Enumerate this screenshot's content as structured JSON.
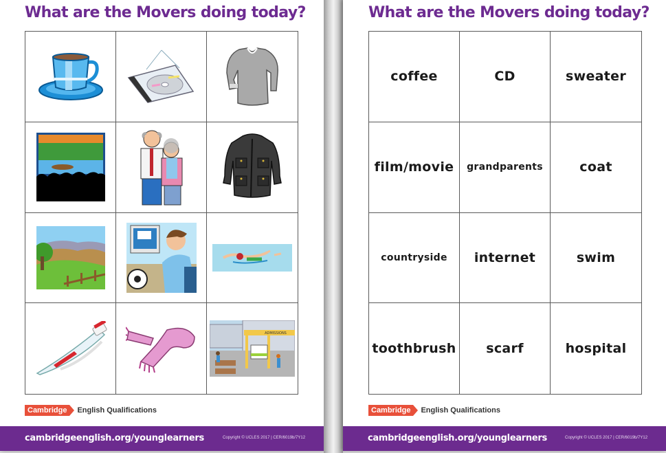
{
  "left_page": {
    "title": "What are the Movers doing today?",
    "picture_cards": [
      {
        "icon": "coffee-cup-icon",
        "label": "coffee"
      },
      {
        "icon": "cd-icon",
        "label": "CD"
      },
      {
        "icon": "sweater-icon",
        "label": "sweater"
      },
      {
        "icon": "film-icon",
        "label": "film/movie"
      },
      {
        "icon": "grandparents-icon",
        "label": "grandparents"
      },
      {
        "icon": "coat-icon",
        "label": "coat"
      },
      {
        "icon": "countryside-icon",
        "label": "countryside"
      },
      {
        "icon": "internet-icon",
        "label": "internet"
      },
      {
        "icon": "swim-icon",
        "label": "swim"
      },
      {
        "icon": "toothbrush-icon",
        "label": "toothbrush"
      },
      {
        "icon": "scarf-icon",
        "label": "scarf"
      },
      {
        "icon": "hospital-icon",
        "label": "hospital"
      }
    ],
    "hospital_sign": "ADMISSIONS",
    "logo": {
      "brand": "Cambridge",
      "tagline": "English Qualifications"
    },
    "footer": {
      "url": "cambridgeenglish.org/younglearners",
      "copyright": "Copyright © UCLES 2017 | CER/6019b/7Y12"
    }
  },
  "right_page": {
    "title": "What are the Movers doing today?",
    "word_cards": [
      "coffee",
      "CD",
      "sweater",
      "film/movie",
      "grandparents",
      "coat",
      "countryside",
      "internet",
      "swim",
      "toothbrush",
      "scarf",
      "hospital"
    ],
    "logo": {
      "brand": "Cambridge",
      "tagline": "English Qualifications"
    },
    "footer": {
      "url": "cambridgeenglish.org/younglearners",
      "copyright": "Copyright © UCLES 2017 | CER/6019b/7Y12"
    }
  },
  "colors": {
    "title_purple": "#6d2b91",
    "footer_purple": "#6c2b8f",
    "cambridge_red": "#e8503a"
  }
}
